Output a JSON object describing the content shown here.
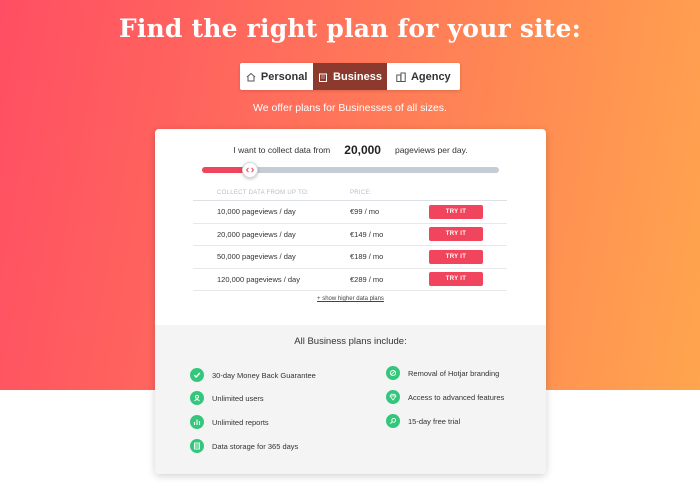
{
  "header": {
    "title": "Find the right plan for your site:",
    "subtitle": "We offer plans for Businesses of all sizes."
  },
  "tabs": [
    {
      "label": "Personal",
      "icon": "house-icon",
      "active": false
    },
    {
      "label": "Business",
      "icon": "building-icon",
      "active": true
    },
    {
      "label": "Agency",
      "icon": "buildings-icon",
      "active": false
    }
  ],
  "collect": {
    "prefix": "I want to collect data from",
    "value": "20,000",
    "suffix": "pageviews per day.",
    "slider_fraction": 0.16
  },
  "table": {
    "headers": [
      "COLLECT DATA FROM UP TO:",
      "PRICE:"
    ],
    "rows": [
      {
        "pageviews": "10,000 pageviews / day",
        "price": "€99 / mo",
        "action": "TRY IT"
      },
      {
        "pageviews": "20,000 pageviews / day",
        "price": "€149 / mo",
        "action": "TRY IT"
      },
      {
        "pageviews": "50,000 pageviews / day",
        "price": "€189 / mo",
        "action": "TRY IT"
      },
      {
        "pageviews": "120,000 pageviews / day",
        "price": "€289 / mo",
        "action": "TRY IT"
      }
    ],
    "more_link": "+ show higher data plans"
  },
  "includes": {
    "title": "All Business plans include:",
    "left": [
      {
        "label": "30-day Money Back Guarantee",
        "icon": "check-badge-icon"
      },
      {
        "label": "Unlimited users",
        "icon": "users-icon"
      },
      {
        "label": "Unlimited reports",
        "icon": "chart-icon"
      },
      {
        "label": "Data storage for 365 days",
        "icon": "storage-icon"
      }
    ],
    "right": [
      {
        "label": "Removal of Hotjar branding",
        "icon": "no-branding-icon"
      },
      {
        "label": "Access to advanced features",
        "icon": "diamond-icon"
      },
      {
        "label": "15-day free trial",
        "icon": "search-icon"
      }
    ]
  },
  "colors": {
    "accent": "#f0455c",
    "active_tab": "#8c3a2e",
    "feature_icon": "#34c77b"
  }
}
